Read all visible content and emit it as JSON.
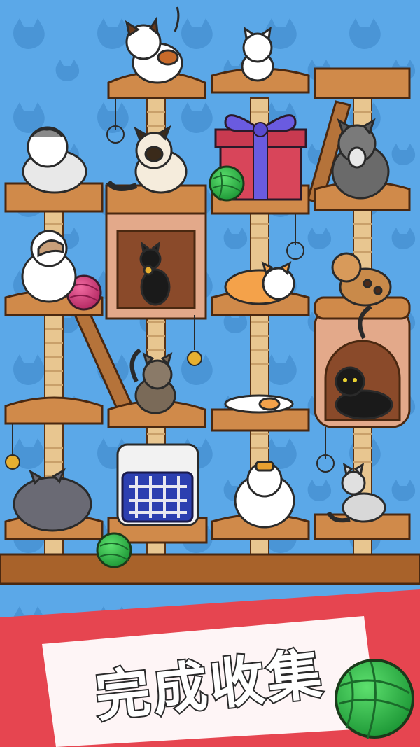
{
  "caption": "完成收集",
  "colors": {
    "background": "#5ba8e8",
    "pattern": "#4a95d6",
    "wood": "#d08a4a",
    "wood_dark": "#8a4a1e",
    "post": "#e8c690",
    "banner": "#e64550",
    "yarn_green": "#2fb54a",
    "yarn_pink": "#d6397a",
    "gift": "#d8455a",
    "ribbon": "#6a5be0"
  },
  "objects": [
    {
      "name": "calico-cat",
      "shelf": "top-left"
    },
    {
      "name": "white-cat",
      "shelf": "top-center"
    },
    {
      "name": "gray-fold-cat",
      "shelf": "row2-left"
    },
    {
      "name": "siamese-cat",
      "shelf": "row2-center-left"
    },
    {
      "name": "gift-box",
      "shelf": "row2-center-right"
    },
    {
      "name": "maine-coon-cat",
      "shelf": "row2-right"
    },
    {
      "name": "ragdoll-cat",
      "shelf": "row3-left"
    },
    {
      "name": "egyptian-black-cat",
      "shelf": "row3-house"
    },
    {
      "name": "orange-white-cat",
      "shelf": "row3-center-right"
    },
    {
      "name": "bengal-cat",
      "shelf": "row3-right"
    },
    {
      "name": "tabby-cat",
      "shelf": "row4-center-left"
    },
    {
      "name": "sleeping-calico-cat",
      "shelf": "row4-center-right"
    },
    {
      "name": "black-cat-in-tube",
      "shelf": "row4-right"
    },
    {
      "name": "gray-chubby-cat",
      "shelf": "row5-left"
    },
    {
      "name": "pet-carrier",
      "shelf": "row5-center-left"
    },
    {
      "name": "fat-white-cat",
      "shelf": "row5-center-right"
    },
    {
      "name": "silver-tabby-cat",
      "shelf": "row5-right"
    }
  ]
}
